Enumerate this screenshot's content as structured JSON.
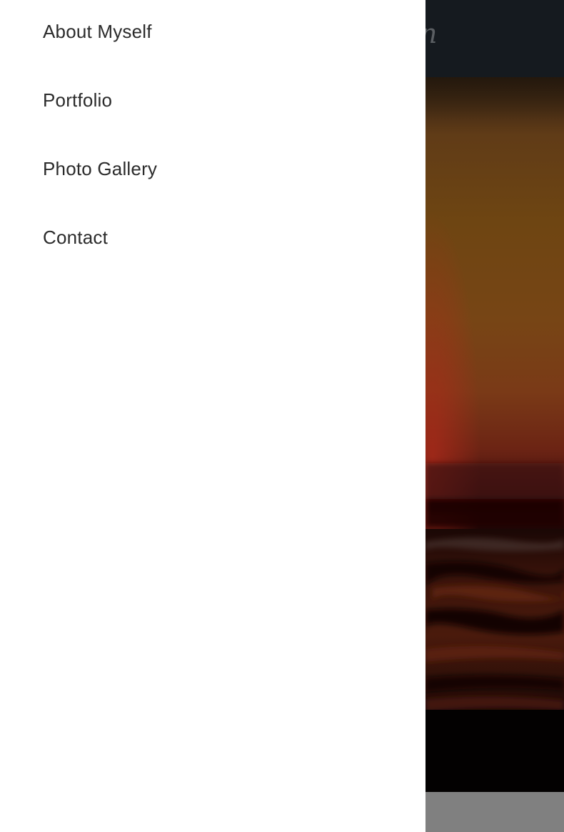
{
  "drawer": {
    "items": [
      {
        "label": "About Myself"
      },
      {
        "label": "Portfolio"
      },
      {
        "label": "Photo Gallery"
      },
      {
        "label": "Contact"
      }
    ]
  },
  "header": {
    "logo_fragment": "n"
  },
  "colors": {
    "drawer_bg": "#ffffff",
    "menu_text": "#2b2b2b",
    "topbar_bg": "#151a1f",
    "footer_strip": "#808080"
  },
  "hero": {
    "image": "sunset-over-sea-photo"
  }
}
